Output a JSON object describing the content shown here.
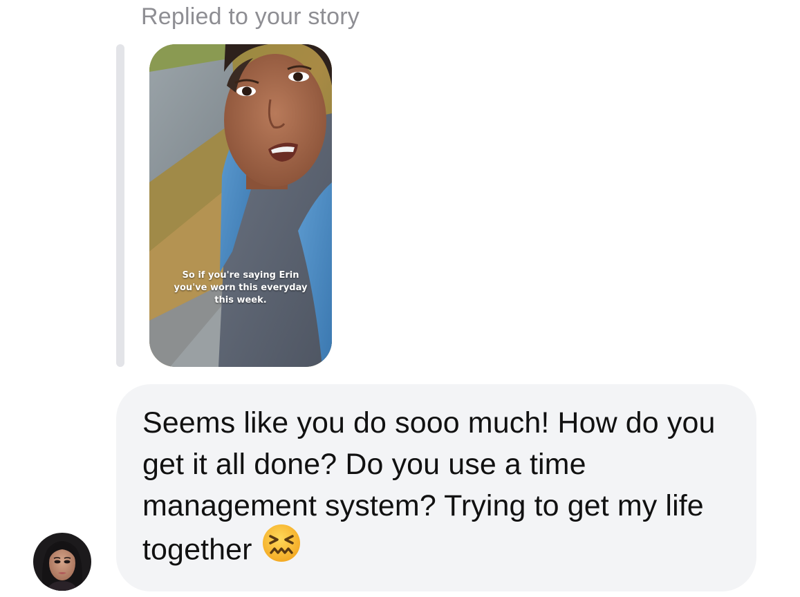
{
  "reply_header": "Replied to your story",
  "story": {
    "caption_lines": [
      "So if you're saying Erin",
      "you've worn this everyday",
      "this week."
    ]
  },
  "message": {
    "text": "Seems like you do sooo much! How do you get it all done? Do you use a time management system? Trying to get my life together",
    "emoji": "confounded-face-emoji"
  },
  "avatar": {
    "icon": "sender-avatar"
  },
  "colors": {
    "header_gray": "#8e8e93",
    "bubble_bg": "#f3f4f6",
    "reply_bar": "#e3e4e8",
    "text": "#111111"
  }
}
